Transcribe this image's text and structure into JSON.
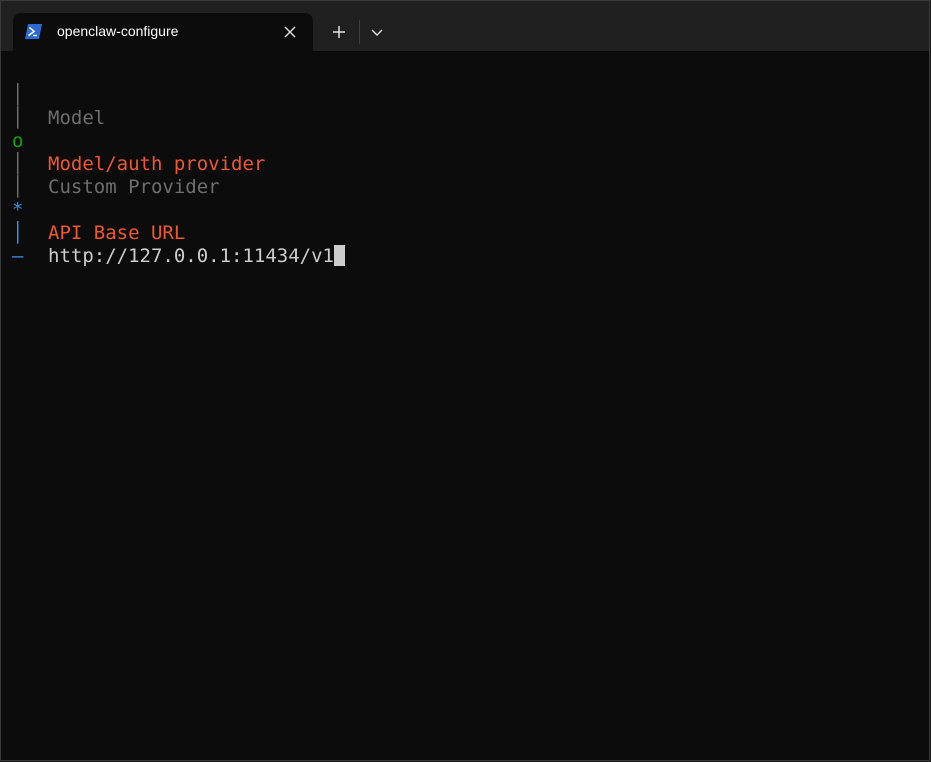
{
  "tab": {
    "title": "openclaw-configure",
    "icon": "powershell-icon"
  },
  "controls": {
    "new_tab": "+",
    "dropdown": "chevron-down-icon",
    "close": "close-icon"
  },
  "terminal": {
    "lines": [
      {
        "gutter": "│",
        "text": "Model"
      },
      {
        "gutter": "│",
        "text": ""
      },
      {
        "gutter": "o",
        "text": "Model/auth provider"
      },
      {
        "gutter": "│",
        "text": "Custom Provider"
      },
      {
        "gutter": "│",
        "text": ""
      },
      {
        "gutter": "*",
        "text": "API Base URL"
      },
      {
        "gutter": "│",
        "text": "http://127.0.0.1:11434/v1"
      },
      {
        "gutter": "—",
        "text": ""
      }
    ]
  },
  "colors": {
    "background": "#0c0c0c",
    "titlebar": "#202020",
    "gray": "#6e6e6e",
    "green": "#13a10e",
    "orange": "#f0572d",
    "blue": "#3b8eea",
    "foreground": "#cccccc"
  }
}
